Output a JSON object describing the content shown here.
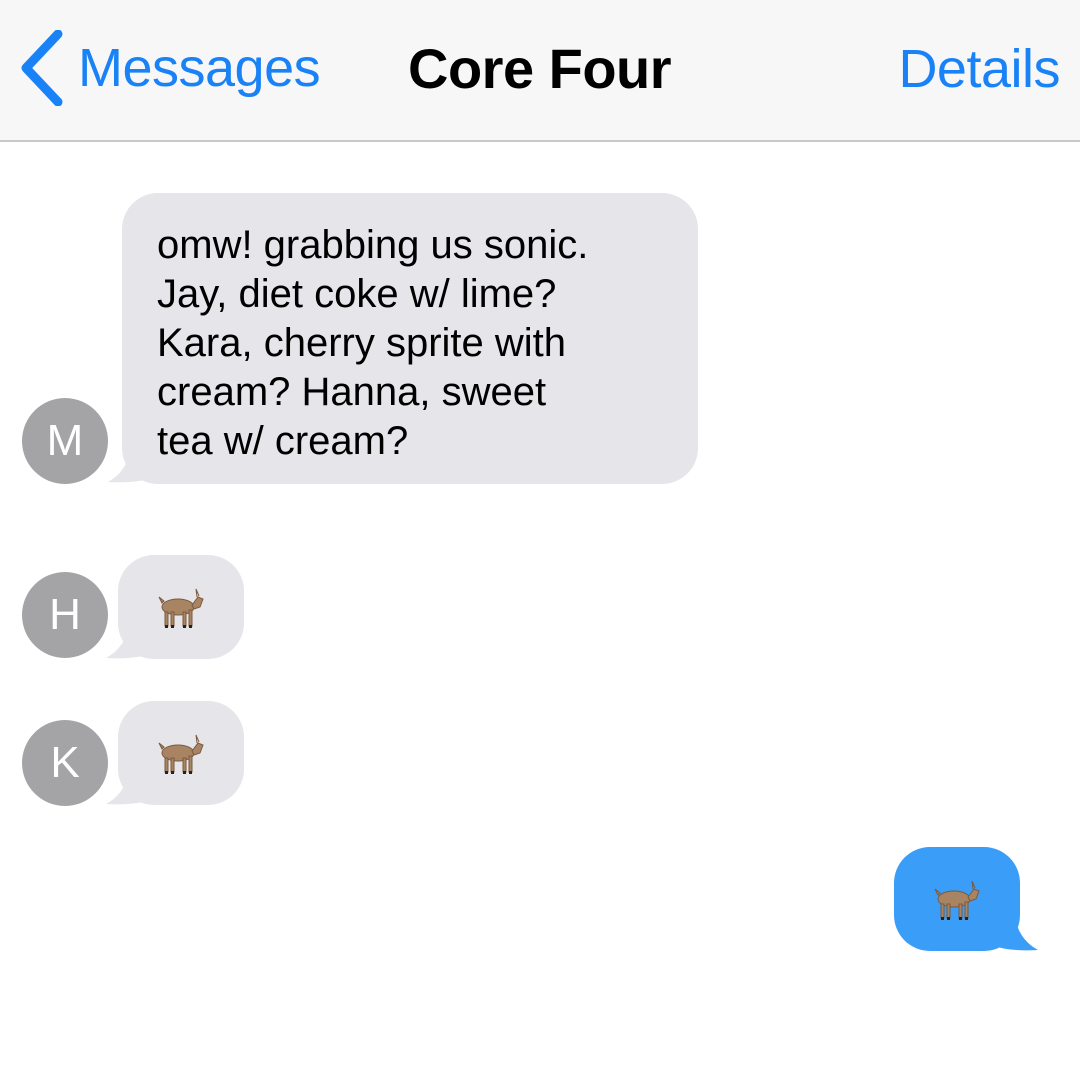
{
  "nav": {
    "back_label": "Messages",
    "title": "Core Four",
    "details_label": "Details"
  },
  "colors": {
    "accent": "#1a82f7",
    "incoming_bubble": "#e5e5ea",
    "outgoing_bubble": "#3a9df7",
    "avatar": "#a4a4a6"
  },
  "messages": [
    {
      "sender_initial": "M",
      "direction": "incoming",
      "lines": [
        "omw! grabbing us sonic.",
        "Jay, diet coke w/ lime?",
        "Kara, cherry sprite with",
        "cream? Hanna, sweet",
        "tea w/ cream?"
      ]
    },
    {
      "sender_initial": "H",
      "direction": "incoming",
      "emoji": "goat-emoji"
    },
    {
      "sender_initial": "K",
      "direction": "incoming",
      "emoji": "goat-emoji"
    },
    {
      "direction": "outgoing",
      "emoji": "goat-emoji"
    }
  ]
}
